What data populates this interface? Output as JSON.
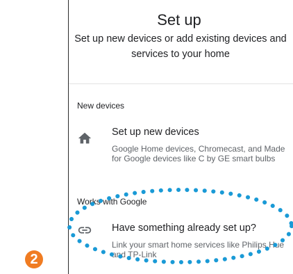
{
  "header": {
    "title": "Set up",
    "subtitle": "Set up new devices or add existing devices and services to your home"
  },
  "sections": {
    "new_devices": {
      "header": "New devices",
      "item": {
        "icon": "home-icon",
        "title": "Set up new devices",
        "description": "Google Home devices, Chromecast, and Made for Google devices like C by GE smart bulbs"
      }
    },
    "works_with": {
      "header": "Works with Google",
      "item": {
        "icon": "link-icon",
        "title": "Have something already set up?",
        "description": "Link your smart home services like Philips Hue and TP-Link"
      }
    }
  },
  "annotation": {
    "step_number": "2",
    "badge_color": "#f07c22",
    "highlight_color": "#1a9ad6"
  }
}
